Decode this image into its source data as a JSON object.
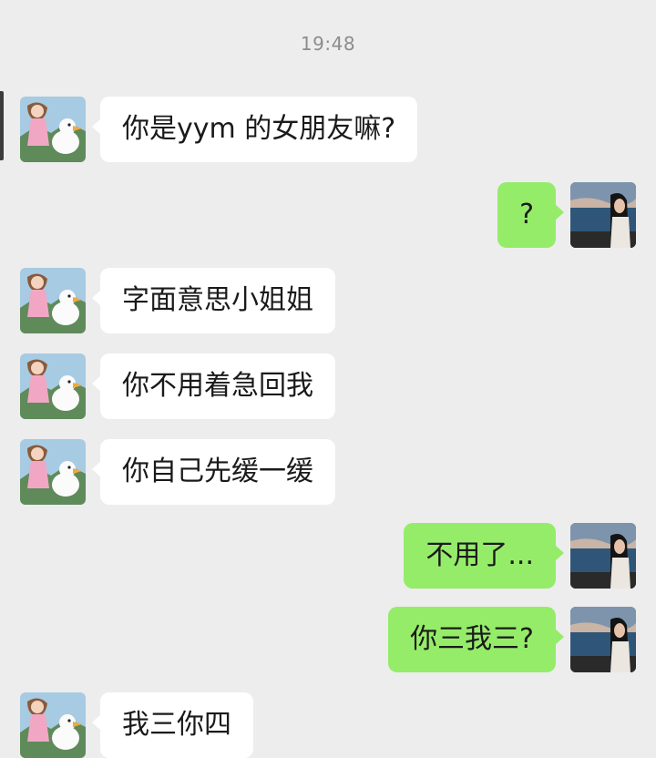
{
  "chat": {
    "timestamp": "19:48",
    "messages": [
      {
        "side": "in",
        "text": "你是yym 的女朋友嘛?"
      },
      {
        "side": "out",
        "text": "?"
      },
      {
        "side": "in",
        "text": "字面意思小姐姐"
      },
      {
        "side": "in",
        "text": "你不用着急回我"
      },
      {
        "side": "in",
        "text": "你自己先缓一缓"
      },
      {
        "side": "out",
        "text": "不用了..."
      },
      {
        "side": "out",
        "text": "你三我三?"
      },
      {
        "side": "in",
        "text": "我三你四"
      }
    ]
  },
  "colors": {
    "background": "#ededed",
    "incoming_bubble": "#ffffff",
    "outgoing_bubble": "#95ec69",
    "timestamp_text": "#8c8c8c"
  },
  "icons": {
    "incoming_avatar": "anime-girl-with-duck-avatar",
    "outgoing_avatar": "woman-by-lake-photo-avatar"
  }
}
